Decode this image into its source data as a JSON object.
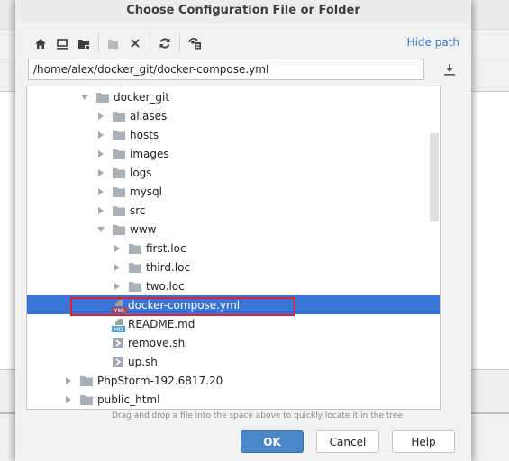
{
  "dialog": {
    "title": "Choose Configuration File or Folder",
    "hide_path_label": "Hide path",
    "path_value": "/home/alex/docker_git/docker-compose.yml",
    "hint": "Drag and drop a file into the space above to quickly locate it in the tree"
  },
  "toolbar": {
    "items": [
      {
        "icon": "home-icon",
        "label": "Home"
      },
      {
        "icon": "desktop-icon",
        "label": "Desktop"
      },
      {
        "icon": "project-folder-icon",
        "label": "Project"
      },
      {
        "icon": "new-folder-icon",
        "label": "New Folder"
      },
      {
        "icon": "delete-icon",
        "label": "Delete"
      },
      {
        "icon": "refresh-icon",
        "label": "Refresh"
      },
      {
        "icon": "show-hidden-icon",
        "label": "Show Hidden Files"
      }
    ]
  },
  "tree": {
    "rows": [
      {
        "label": "docker_git",
        "type": "folder",
        "expanded": true,
        "level": 0
      },
      {
        "label": "aliases",
        "type": "folder",
        "expanded": false,
        "level": 1
      },
      {
        "label": "hosts",
        "type": "folder",
        "expanded": false,
        "level": 1
      },
      {
        "label": "images",
        "type": "folder",
        "expanded": false,
        "level": 1
      },
      {
        "label": "logs",
        "type": "folder",
        "expanded": false,
        "level": 1
      },
      {
        "label": "mysql",
        "type": "folder",
        "expanded": false,
        "level": 1
      },
      {
        "label": "src",
        "type": "folder",
        "expanded": false,
        "level": 1
      },
      {
        "label": "www",
        "type": "folder",
        "expanded": true,
        "level": 1
      },
      {
        "label": "first.loc",
        "type": "folder",
        "expanded": false,
        "level": 2
      },
      {
        "label": "third.loc",
        "type": "folder",
        "expanded": false,
        "level": 2
      },
      {
        "label": "two.loc",
        "type": "folder",
        "expanded": false,
        "level": 2
      },
      {
        "label": "docker-compose.yml",
        "type": "yml",
        "level": 1,
        "selected": true,
        "badge": "YML"
      },
      {
        "label": "README.md",
        "type": "md",
        "level": 1,
        "badge": "MD"
      },
      {
        "label": "remove.sh",
        "type": "sh",
        "level": 1
      },
      {
        "label": "up.sh",
        "type": "sh",
        "level": 1
      },
      {
        "label": "PhpStorm-192.6817.20",
        "type": "folder",
        "expanded": false,
        "level": -1
      },
      {
        "label": "public_html",
        "type": "folder",
        "expanded": false,
        "level": -1
      }
    ]
  },
  "buttons": {
    "ok": "OK",
    "cancel": "Cancel",
    "help": "Help"
  },
  "colors": {
    "selection": "#3875d7",
    "highlight_box": "#e0202e",
    "link": "#3a74c8",
    "ok_button": "#4a86c8"
  }
}
